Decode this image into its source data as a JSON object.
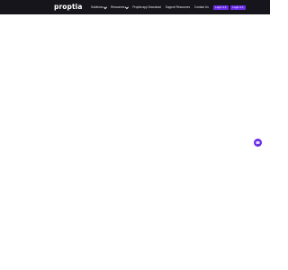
{
  "brand": {
    "logo_text": "proptia"
  },
  "nav": {
    "items": [
      {
        "label": "Solutions",
        "has_dropdown": true
      },
      {
        "label": "Resources",
        "has_dropdown": true
      },
      {
        "label": "Proptia app Download",
        "has_dropdown": false
      },
      {
        "label": "Support Resources",
        "has_dropdown": false
      },
      {
        "label": "Contact Us",
        "has_dropdown": false
      }
    ],
    "buttons": [
      {
        "label": "Login 1:1"
      },
      {
        "label": "Login 1:1"
      }
    ]
  },
  "chat": {
    "icon": "chat-bubble-icon"
  },
  "colors": {
    "navbar_bg": "#16151b",
    "accent": "#6a2ce8",
    "page_bg": "#ffffff"
  }
}
